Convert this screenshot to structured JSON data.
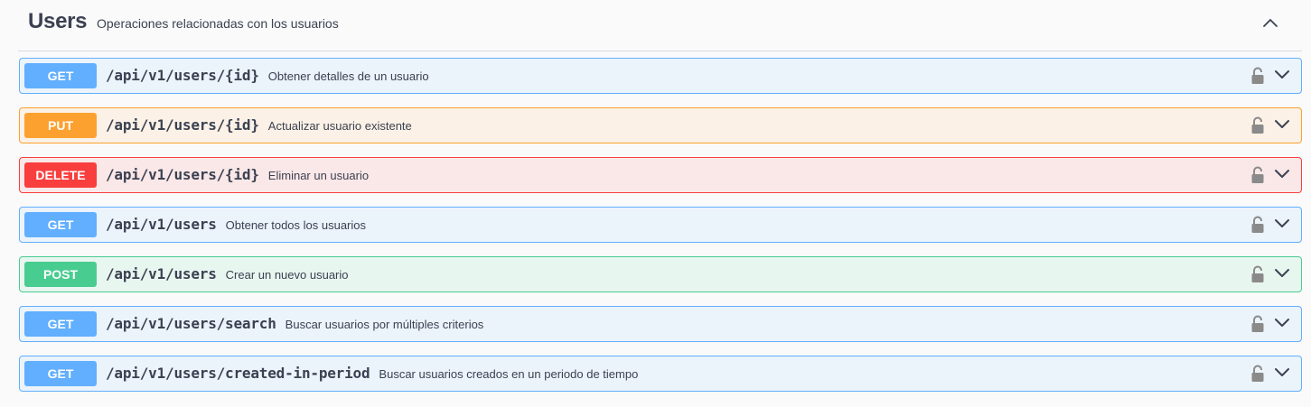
{
  "tag": {
    "name": "Users",
    "description": "Operaciones relacionadas con los usuarios",
    "expanded": true
  },
  "operations": [
    {
      "method": "GET",
      "path": "/api/v1/users/{id}",
      "summary": "Obtener detalles de un usuario"
    },
    {
      "method": "PUT",
      "path": "/api/v1/users/{id}",
      "summary": "Actualizar usuario existente"
    },
    {
      "method": "DELETE",
      "path": "/api/v1/users/{id}",
      "summary": "Eliminar un usuario"
    },
    {
      "method": "GET",
      "path": "/api/v1/users",
      "summary": "Obtener todos los usuarios"
    },
    {
      "method": "POST",
      "path": "/api/v1/users",
      "summary": "Crear un nuevo usuario"
    },
    {
      "method": "GET",
      "path": "/api/v1/users/search",
      "summary": "Buscar usuarios por múltiples criterios"
    },
    {
      "method": "GET",
      "path": "/api/v1/users/created-in-period",
      "summary": "Buscar usuarios creados en un periodo de tiempo"
    }
  ],
  "colors": {
    "get": "#61affe",
    "put": "#fca130",
    "delete": "#f93e3e",
    "post": "#49cc90"
  },
  "icons": {
    "collapse": "chevron-up-icon",
    "lock": "lock-icon",
    "expand": "chevron-down-icon"
  }
}
